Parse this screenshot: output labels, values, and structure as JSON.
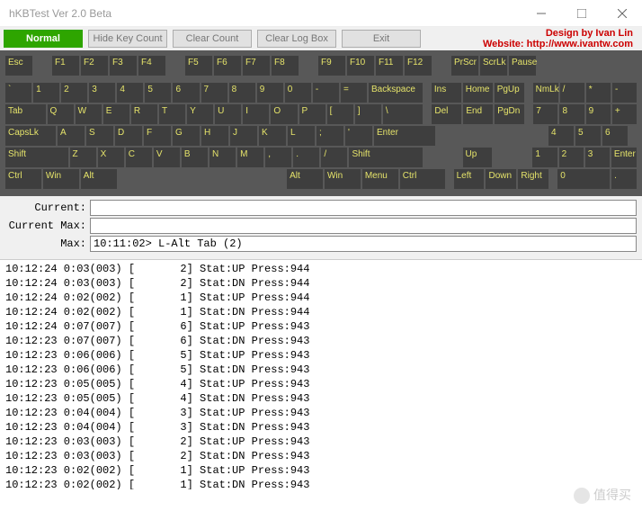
{
  "window": {
    "title": "hKBTest Ver 2.0 Beta"
  },
  "toolbar": {
    "normal": "Normal",
    "hide": "Hide Key Count",
    "clear_count": "Clear Count",
    "clear_log": "Clear Log Box",
    "exit": "Exit"
  },
  "credit": {
    "line1": "Design by Ivan Lin",
    "line2": "Website: http://www.ivantw.com"
  },
  "keyboard": {
    "row0": [
      "Esc",
      "",
      "F1",
      "F2",
      "F3",
      "F4",
      "",
      "F5",
      "F6",
      "F7",
      "F8",
      "",
      "F9",
      "F10",
      "F11",
      "F12",
      "",
      "PrScr",
      "ScrLk",
      "Pause"
    ],
    "row1_main": [
      "`",
      "1",
      "2",
      "3",
      "4",
      "5",
      "6",
      "7",
      "8",
      "9",
      "0",
      "-",
      "=",
      "Backspace"
    ],
    "row1_nav": [
      "Ins",
      "Home",
      "PgUp"
    ],
    "row1_num": [
      "NmLk",
      "/",
      "*",
      "-"
    ],
    "row2_main": [
      "Tab",
      "Q",
      "W",
      "E",
      "R",
      "T",
      "Y",
      "U",
      "I",
      "O",
      "P",
      "[",
      "]",
      "\\"
    ],
    "row2_nav": [
      "Del",
      "End",
      "PgDn"
    ],
    "row2_num": [
      "7",
      "8",
      "9",
      "+"
    ],
    "row3_main": [
      "CapsLk",
      "A",
      "S",
      "D",
      "F",
      "G",
      "H",
      "J",
      "K",
      "L",
      ";",
      "'",
      "Enter"
    ],
    "row3_num": [
      "4",
      "5",
      "6"
    ],
    "row4_main": [
      "Shift",
      "Z",
      "X",
      "C",
      "V",
      "B",
      "N",
      "M",
      ",",
      ".",
      "/",
      "Shift"
    ],
    "row4_nav": [
      "Up"
    ],
    "row4_num": [
      "1",
      "2",
      "3",
      "Enter"
    ],
    "row5_main": [
      "Ctrl",
      "Win",
      "Alt",
      "",
      "Alt",
      "Win",
      "Menu",
      "Ctrl"
    ],
    "row5_nav": [
      "Left",
      "Down",
      "Right"
    ],
    "row5_num": [
      "0",
      "."
    ]
  },
  "fields": {
    "current_label": "Current:",
    "current_value": "",
    "currentmax_label": "Current Max:",
    "currentmax_value": "",
    "max_label": "Max:",
    "max_value": "10:11:02> L-Alt Tab (2)"
  },
  "log": [
    "10:12:24 0:03(003) [       2] Stat:UP Press:944",
    "10:12:24 0:03(003) [       2] Stat:DN Press:944",
    "10:12:24 0:02(002) [       1] Stat:UP Press:944",
    "10:12:24 0:02(002) [       1] Stat:DN Press:944",
    "10:12:24 0:07(007) [       6] Stat:UP Press:943",
    "10:12:23 0:07(007) [       6] Stat:DN Press:943",
    "10:12:23 0:06(006) [       5] Stat:UP Press:943",
    "10:12:23 0:06(006) [       5] Stat:DN Press:943",
    "10:12:23 0:05(005) [       4] Stat:UP Press:943",
    "10:12:23 0:05(005) [       4] Stat:DN Press:943",
    "10:12:23 0:04(004) [       3] Stat:UP Press:943",
    "10:12:23 0:04(004) [       3] Stat:DN Press:943",
    "10:12:23 0:03(003) [       2] Stat:UP Press:943",
    "10:12:23 0:03(003) [       2] Stat:DN Press:943",
    "10:12:23 0:02(002) [       1] Stat:UP Press:943",
    "10:12:23 0:02(002) [       1] Stat:DN Press:943"
  ],
  "watermark": "值得买"
}
